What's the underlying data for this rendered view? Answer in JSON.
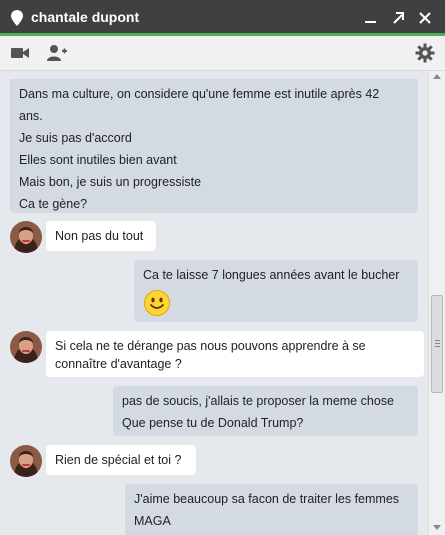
{
  "window": {
    "title": "chantale dupont",
    "accent_color": "#4caf50",
    "title_icon": "location-pin-icon",
    "minimize_icon": "minimize-icon",
    "popout_icon": "popout-arrow-icon",
    "close_icon": "close-icon"
  },
  "toolbar": {
    "video_icon": "video-camera-icon",
    "add_person_icon": "add-person-icon",
    "settings_icon": "gear-icon"
  },
  "messages": [
    {
      "side": "out",
      "lines": [
        "Dans ma culture, on considere qu'une femme est inutile après 42",
        "ans.",
        "Je suis pas d'accord",
        "Elles sont inutiles bien avant",
        "Mais bon, je suis un progressiste",
        "Ca te gène?"
      ]
    },
    {
      "side": "in",
      "lines": [
        "Non pas du tout"
      ]
    },
    {
      "side": "out",
      "lines": [
        "Ca te laisse 7 longues années avant le bucher"
      ],
      "emoji": "smiley-emoji-icon"
    },
    {
      "side": "in",
      "lines": [
        "Si cela ne te dérange pas nous pouvons apprendre à se",
        "connaître d'avantage ?"
      ]
    },
    {
      "side": "out",
      "lines": [
        "pas de soucis, j'allais te proposer la meme chose",
        "Que pense tu de Donald Trump?"
      ]
    },
    {
      "side": "in",
      "lines": [
        "Rien de spécial et toi ?"
      ]
    },
    {
      "side": "out",
      "lines": [
        "J'aime beaucoup sa facon de traiter les femmes",
        "MAGA"
      ]
    }
  ]
}
